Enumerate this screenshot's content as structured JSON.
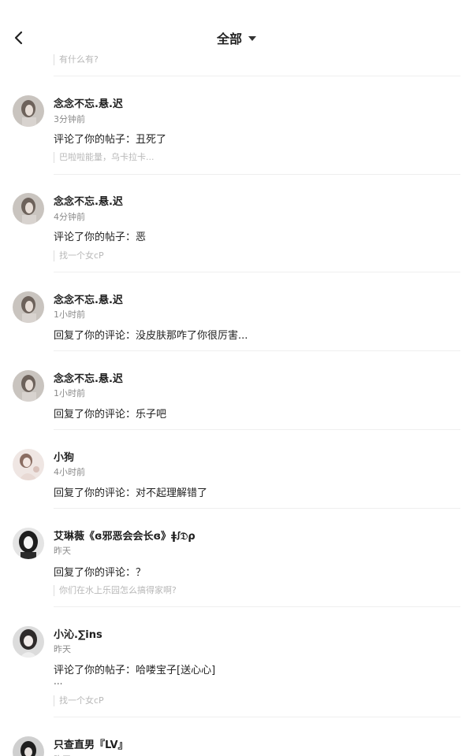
{
  "header": {
    "title": "全部",
    "back_icon": "chevron-left-icon",
    "dropdown_icon": "caret-down-icon"
  },
  "partial_quote": "有什么有?",
  "notifications": [
    {
      "name": "念念不忘.悬.迟",
      "time": "3分钟前",
      "content": "评论了你的帖子：丑死了",
      "quote": "巴啦啦能量，乌卡拉卡..."
    },
    {
      "name": "念念不忘.悬.迟",
      "time": "4分钟前",
      "content": "评论了你的帖子：恶",
      "quote": "找一个女cP"
    },
    {
      "name": "念念不忘.悬.迟",
      "time": "1小时前",
      "content": "回复了你的评论：没皮肤那咋了你很厉害...",
      "quote": ""
    },
    {
      "name": "念念不忘.悬.迟",
      "time": "1小时前",
      "content": "回复了你的评论：乐子吧",
      "quote": ""
    },
    {
      "name": "小狗",
      "time": "4小时前",
      "content": "回复了你的评论：对不起理解错了",
      "quote": ""
    },
    {
      "name": "艾琳薇《ɞ邪恶会会长ɞ》ǂꭍ𝔇ρ",
      "time": "昨天",
      "content": "回复了你的评论：？",
      "quote": "你们在水上乐园怎么搞得家啊?"
    },
    {
      "name": "小沁.∑ins",
      "time": "昨天",
      "content": "评论了你的帖子：哈喽宝子[送心心]",
      "extra": "...",
      "quote": "找一个女cP"
    },
    {
      "name": "只查直男『LV』",
      "time": "昨天",
      "content": "",
      "quote": ""
    }
  ],
  "colors": {
    "name": "#1e1e1e",
    "time": "#8a8a8a",
    "quote": "#b8b8b8",
    "divider": "#efefef"
  }
}
